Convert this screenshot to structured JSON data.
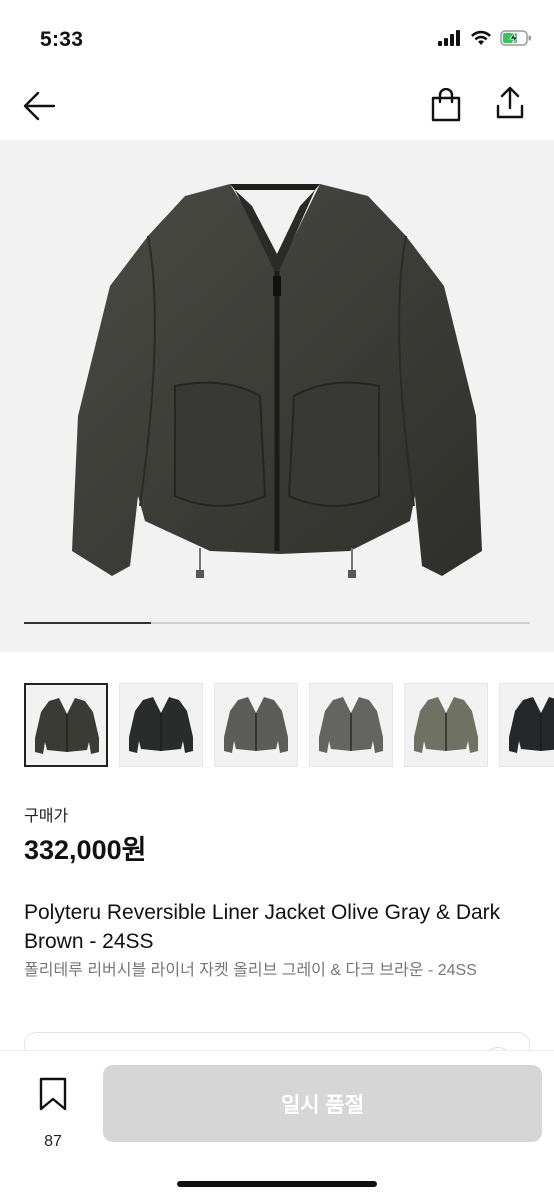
{
  "status_bar": {
    "time": "5:33"
  },
  "nav": {
    "back_icon": "arrow-left-icon",
    "bag_icon": "shopping-bag-icon",
    "share_icon": "share-icon"
  },
  "gallery": {
    "progress": 0.25,
    "thumbnails": [
      {
        "label": "olive-gray-front",
        "color": "#3a3b35",
        "active": true
      },
      {
        "label": "black-front",
        "color": "#2a2b2b",
        "active": false
      },
      {
        "label": "gray-front",
        "color": "#5c5d58",
        "active": false
      },
      {
        "label": "gray-front-2",
        "color": "#646560",
        "active": false
      },
      {
        "label": "olive-front",
        "color": "#6f7262",
        "active": false
      },
      {
        "label": "black-front-2",
        "color": "#26272a",
        "active": false
      }
    ]
  },
  "product": {
    "price_label": "구매가",
    "price": "332,000원",
    "title_en": "Polyteru Reversible Liner Jacket Olive Gray & Dark Brown - 24SS",
    "title_ko": "폴리테루 리버시블 라이너 자켓 올리브 그레이 & 다크 브라운 - 24SS"
  },
  "info_card": {
    "text": ""
  },
  "bottom": {
    "wish_count": "87",
    "buy_label": "일시 품절"
  },
  "colors": {
    "disabled_button": "#d6d6d6",
    "hero_bg": "#f2f2f2",
    "jacket": "#3a3b35"
  }
}
